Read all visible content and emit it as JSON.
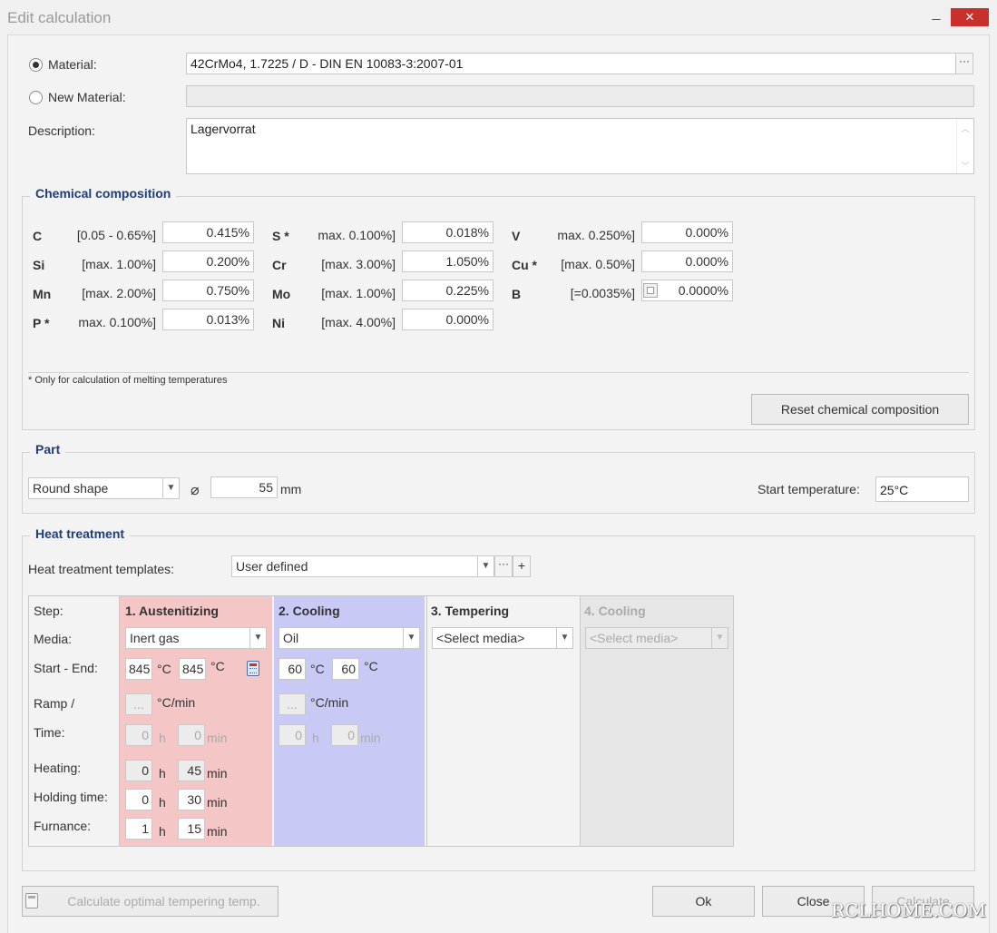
{
  "window": {
    "title": "Edit calculation",
    "minimize": "_",
    "close": "✕"
  },
  "material": {
    "label": "Material:",
    "value": "42CrMo4, 1.7225 / D - DIN EN 10083-3:2007-01",
    "browse": "···",
    "new_label": "New Material:",
    "new_value": "",
    "description_label": "Description:",
    "description_value": "Lagervorrat",
    "selected": "Material"
  },
  "chem": {
    "title": "Chemical composition",
    "elements": [
      {
        "el": "C",
        "range": "[0.05 - 0.65%]",
        "value": "0.415%"
      },
      {
        "el": "Si",
        "range": "[max. 1.00%]",
        "value": "0.200%"
      },
      {
        "el": "Mn",
        "range": "[max. 2.00%]",
        "value": "0.750%"
      },
      {
        "el": "P *",
        "range": "max. 0.100%]",
        "value": "0.013%"
      },
      {
        "el": "S *",
        "range": "max. 0.100%]",
        "value": "0.018%"
      },
      {
        "el": "Cr",
        "range": "[max. 3.00%]",
        "value": "1.050%"
      },
      {
        "el": "Mo",
        "range": "[max. 1.00%]",
        "value": "0.225%"
      },
      {
        "el": "Ni",
        "range": "[max. 4.00%]",
        "value": "0.000%"
      },
      {
        "el": "V",
        "range": "max. 0.250%]",
        "value": "0.000%"
      },
      {
        "el": "Cu *",
        "range": "[max. 0.50%]",
        "value": "0.000%"
      },
      {
        "el": "B",
        "range": "[=0.0035%]",
        "value": "0.0000%"
      }
    ],
    "footnote": "* Only for calculation of melting temperatures",
    "reset_button": "Reset chemical composition"
  },
  "part": {
    "title": "Part",
    "shape": "Round shape",
    "diameter_symbol": "⌀",
    "diameter": "55",
    "diameter_unit": "mm",
    "start_temp_label": "Start temperature:",
    "start_temp": "25°C"
  },
  "heat": {
    "title": "Heat treatment",
    "templates_label": "Heat treatment templates:",
    "template": "User defined",
    "template_browse": "···",
    "template_add": "+",
    "row_labels": {
      "step": "Step:",
      "media": "Media:",
      "start_end": "Start - End:",
      "ramp": "Ramp /",
      "time": "Time:",
      "heating": "Heating:",
      "holding": "Holding time:",
      "furnace": "Furnance:"
    },
    "steps": [
      {
        "name": "1. Austenitizing",
        "media": "Inert gas",
        "start": "845",
        "end": "845",
        "unit_c": "°C",
        "ramp": "...",
        "ramp_unit": "°C/min",
        "time_h": "0",
        "time_min": "0",
        "heat_h": "0",
        "heat_min": "45",
        "hold_h": "0",
        "hold_min": "30",
        "furn_h": "1",
        "furn_min": "15",
        "h": "h",
        "min": "min"
      },
      {
        "name": "2. Cooling",
        "media": "Oil",
        "start": "60",
        "end": "60",
        "unit_c": "°C",
        "ramp": "...",
        "ramp_unit": "°C/min",
        "time_h": "0",
        "time_min": "0",
        "h": "h",
        "min": "min"
      },
      {
        "name": "3. Tempering",
        "media": "<Select media>"
      },
      {
        "name": "4. Cooling",
        "media": "<Select media>"
      }
    ]
  },
  "footer": {
    "calc_optimal": "Calculate optimal tempering temp.",
    "ok": "Ok",
    "close": "Close",
    "calculate": "Calculate",
    "watermark": "RCLHOME.COM"
  },
  "colors": {
    "austenitizing": "#f5c6c6",
    "cooling": "#c9c9f5",
    "accent": "#1f3d7a",
    "close": "#c9302c"
  }
}
